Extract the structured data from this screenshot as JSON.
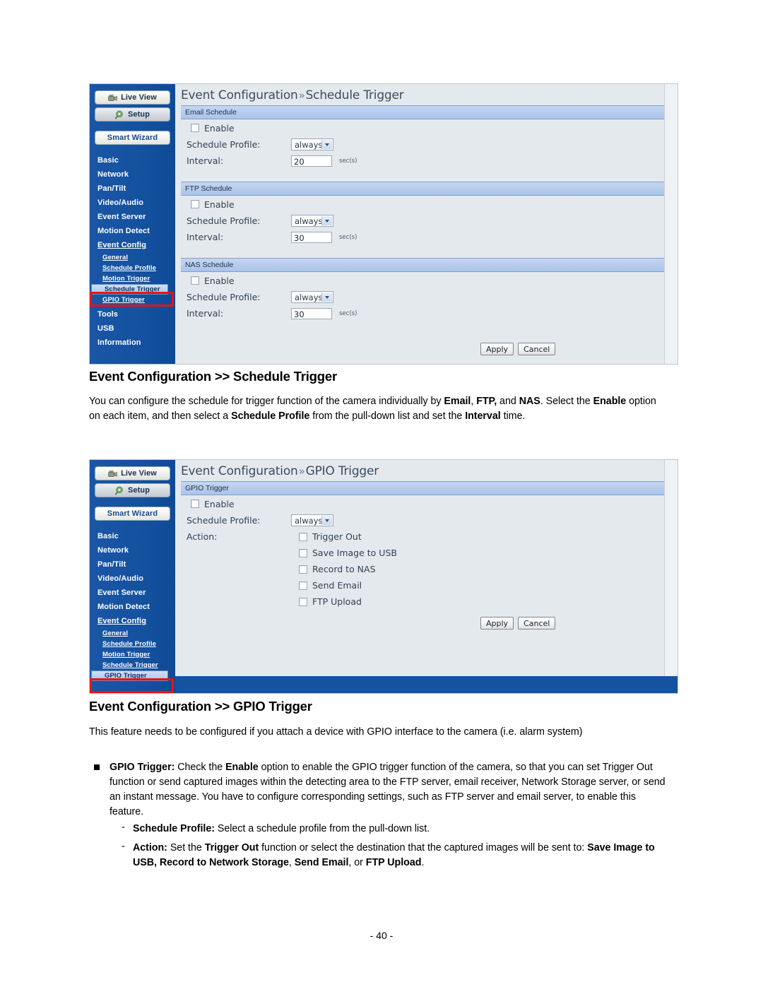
{
  "screenshots": [
    {
      "id": "schedule-trigger",
      "sidebar": {
        "live_view": "Live View",
        "setup": "Setup",
        "smart_wizard": "Smart Wizard",
        "items": [
          {
            "label": "Basic",
            "type": "top"
          },
          {
            "label": "Network",
            "type": "top"
          },
          {
            "label": "Pan/Tilt",
            "type": "top"
          },
          {
            "label": "Video/Audio",
            "type": "top"
          },
          {
            "label": "Event Server",
            "type": "top"
          },
          {
            "label": "Motion Detect",
            "type": "top"
          },
          {
            "label": "Event Config",
            "type": "top-under"
          },
          {
            "label": "General",
            "type": "sub"
          },
          {
            "label": "Schedule Profile",
            "type": "sub"
          },
          {
            "label": "Motion Trigger",
            "type": "sub"
          },
          {
            "label": "Schedule Trigger",
            "type": "sub-selected"
          },
          {
            "label": "GPIO Trigger",
            "type": "sub"
          },
          {
            "label": "Tools",
            "type": "top"
          },
          {
            "label": "USB",
            "type": "top"
          },
          {
            "label": "Information",
            "type": "top"
          }
        ]
      },
      "breadcrumb": {
        "root": "Event Configuration",
        "sep": "»",
        "leaf": "Schedule Trigger"
      },
      "sections": [
        {
          "title": "Email Schedule",
          "enable_label": "Enable",
          "profile_label": "Schedule Profile:",
          "profile_value": "always",
          "interval_label": "Interval:",
          "interval_value": "20",
          "interval_unit": "sec(s)"
        },
        {
          "title": "FTP Schedule",
          "enable_label": "Enable",
          "profile_label": "Schedule Profile:",
          "profile_value": "always",
          "interval_label": "Interval:",
          "interval_value": "30",
          "interval_unit": "sec(s)"
        },
        {
          "title": "NAS Schedule",
          "enable_label": "Enable",
          "profile_label": "Schedule Profile:",
          "profile_value": "always",
          "interval_label": "Interval:",
          "interval_value": "30",
          "interval_unit": "sec(s)"
        }
      ],
      "apply_label": "Apply",
      "cancel_label": "Cancel"
    },
    {
      "id": "gpio-trigger",
      "sidebar": {
        "live_view": "Live View",
        "setup": "Setup",
        "smart_wizard": "Smart Wizard",
        "items": [
          {
            "label": "Basic",
            "type": "top"
          },
          {
            "label": "Network",
            "type": "top"
          },
          {
            "label": "Pan/Tilt",
            "type": "top"
          },
          {
            "label": "Video/Audio",
            "type": "top"
          },
          {
            "label": "Event Server",
            "type": "top"
          },
          {
            "label": "Motion Detect",
            "type": "top"
          },
          {
            "label": "Event Config",
            "type": "top-under"
          },
          {
            "label": "General",
            "type": "sub"
          },
          {
            "label": "Schedule Profile",
            "type": "sub"
          },
          {
            "label": "Motion Trigger",
            "type": "sub"
          },
          {
            "label": "Schedule Trigger",
            "type": "sub"
          },
          {
            "label": "GPIO Trigger",
            "type": "sub-selected"
          }
        ]
      },
      "breadcrumb": {
        "root": "Event Configuration",
        "sep": "»",
        "leaf": "GPIO Trigger"
      },
      "section": {
        "title": "GPIO Trigger",
        "enable_label": "Enable",
        "profile_label": "Schedule Profile:",
        "profile_value": "always",
        "action_label": "Action:",
        "actions": [
          "Trigger Out",
          "Save Image to USB",
          "Record to NAS",
          "Send Email",
          "FTP Upload"
        ]
      },
      "apply_label": "Apply",
      "cancel_label": "Cancel"
    }
  ],
  "doc": {
    "heading1": "Event Configuration >> Schedule Trigger",
    "para1_line1_a": "You can configure the schedule for trigger function of the camera individually by ",
    "para1_b1": "Email",
    "para1_line1_b": ", ",
    "para1_b2": "FTP,",
    "para1_line1_c": " and ",
    "para1_b3": "NAS",
    "para1_line1_d": ".",
    "para1_line2_a": "Select the ",
    "para1_b4": "Enable",
    "para1_line2_b": " option on each item, and then select a ",
    "para1_b5": "Schedule Profile",
    "para1_line2_c": " from the pull-down list and",
    "para1_line3_a": "set the ",
    "para1_b6": "Interval",
    "para1_line3_b": " time.",
    "heading2": "Event Configuration >> GPIO Trigger",
    "para2_line1": "This feature needs to be configured if you attach a device with GPIO interface to the camera (i.e. alarm",
    "para2_line2": "system)",
    "bullet1_b1": "GPIO Trigger:",
    "bullet1_t1": " Check the ",
    "bullet1_b2": "Enable",
    "bullet1_t2": " option to enable the GPIO trigger function of the camera, so that",
    "bullet1_l2": "you can set Trigger Out function or send captured images within the detecting area to the FTP server,",
    "bullet1_l3": "email receiver, Network Storage server, or send an instant message. You have to configure",
    "bullet1_l4": "corresponding settings, such as FTP server and email server, to enable this feature.",
    "sub1_b": "Schedule Profile:",
    "sub1_t": " Select a schedule profile from the pull-down list.",
    "sub2_b": "Action:",
    "sub2_t1": " Set the ",
    "sub2_b2": "Trigger Out",
    "sub2_t2": " function or select the destination that the captured images will be",
    "sub2_l2_t1": "sent to: ",
    "sub2_l2_b1": "Save Image to USB, Record to Network Storage",
    "sub2_l2_t2": ", ",
    "sub2_l2_b2": "Send Email",
    "sub2_l2_t3": ", or ",
    "sub2_l2_b3": "FTP Upload",
    "sub2_l2_t4": ".",
    "page_number": "- 40 -"
  },
  "colors": {
    "sidebar_blue": "#1552a0",
    "section_header_blue": "#aac4ea",
    "pane_bg": "#e4e9ee",
    "highlight_red": "#ee1111"
  }
}
